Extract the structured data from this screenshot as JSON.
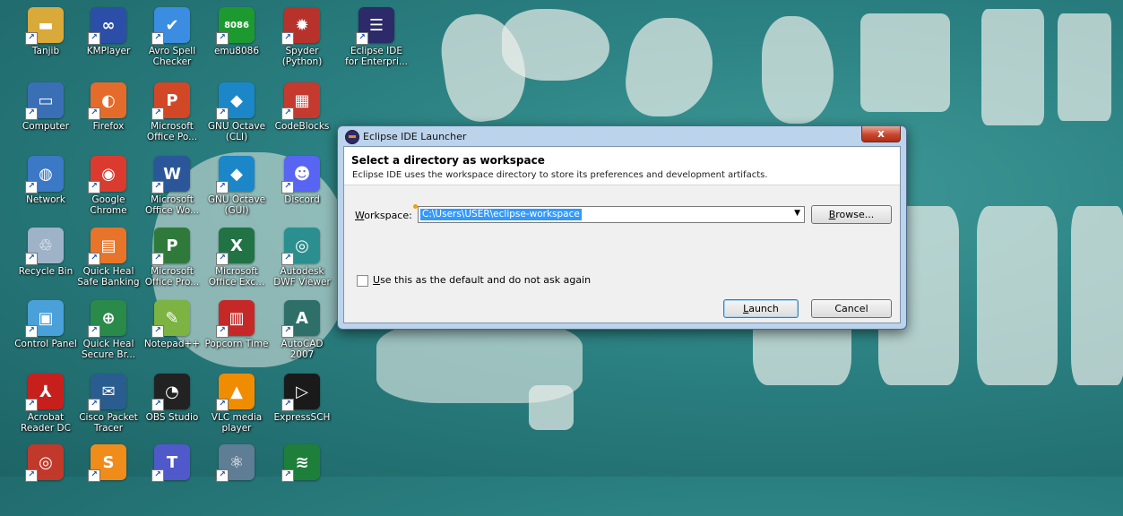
{
  "desktop": {
    "wallpaper_colors": {
      "background": "#2a7f80",
      "ink": "#ebf5f0"
    },
    "icons": [
      {
        "label": "Tanjib",
        "icon": "folder-icon",
        "color": "#d9a93a",
        "glyph": "▬"
      },
      {
        "label": "KMPlayer",
        "icon": "kmplayer-icon",
        "color": "#2b4fa8",
        "glyph": "∞"
      },
      {
        "label": "Avro Spell Checker",
        "icon": "spell-check-icon",
        "color": "#3a8de0",
        "glyph": "✔"
      },
      {
        "label": "emu8086",
        "icon": "chip-icon",
        "color": "#1d9a2f",
        "glyph": "8086"
      },
      {
        "label": "Spyder (Python)",
        "icon": "spider-icon",
        "color": "#b8322c",
        "glyph": "✹"
      },
      {
        "label": "Eclipse IDE for Enterpri...",
        "icon": "eclipse-icon",
        "color": "#2c2a68",
        "glyph": "☰"
      },
      {
        "label": "Computer",
        "icon": "computer-icon",
        "color": "#3b6fb5",
        "glyph": "▭"
      },
      {
        "label": "Firefox",
        "icon": "firefox-icon",
        "color": "#e56b2a",
        "glyph": "◐"
      },
      {
        "label": "Microsoft Office Po...",
        "icon": "powerpoint-icon",
        "color": "#d24726",
        "glyph": "P"
      },
      {
        "label": "GNU Octave (CLI)",
        "icon": "octave-icon",
        "color": "#1b87c9",
        "glyph": "◆"
      },
      {
        "label": "CodeBlocks",
        "icon": "codeblocks-icon",
        "color": "#c43a2f",
        "glyph": "▦"
      },
      {
        "label": "Network",
        "icon": "network-icon",
        "color": "#3b78c6",
        "glyph": "◍"
      },
      {
        "label": "Google Chrome",
        "icon": "chrome-icon",
        "color": "#db3b2f",
        "glyph": "◉"
      },
      {
        "label": "Microsoft Office Wo...",
        "icon": "word-icon",
        "color": "#2b579a",
        "glyph": "W"
      },
      {
        "label": "GNU Octave (GUI)",
        "icon": "octave-icon",
        "color": "#1b87c9",
        "glyph": "◆"
      },
      {
        "label": "Discord",
        "icon": "discord-icon",
        "color": "#5865f2",
        "glyph": "☻"
      },
      {
        "label": "Recycle Bin",
        "icon": "recycle-bin-icon",
        "color": "#9fb3c8",
        "glyph": "♲"
      },
      {
        "label": "Quick Heal Safe Banking",
        "icon": "quickheal-icon",
        "color": "#e8742a",
        "glyph": "▤"
      },
      {
        "label": "Microsoft Office Pro...",
        "icon": "project-icon",
        "color": "#2f7a3b",
        "glyph": "P"
      },
      {
        "label": "Microsoft Office Exc...",
        "icon": "excel-icon",
        "color": "#217346",
        "glyph": "X"
      },
      {
        "label": "Autodesk DWF Viewer",
        "icon": "dwf-viewer-icon",
        "color": "#2c8f8f",
        "glyph": "◎"
      },
      {
        "label": "Control Panel",
        "icon": "control-panel-icon",
        "color": "#4aa0d8",
        "glyph": "▣"
      },
      {
        "label": "Quick Heal Secure Br...",
        "icon": "quickheal-browser-icon",
        "color": "#2a8a4a",
        "glyph": "⊕"
      },
      {
        "label": "Notepad++",
        "icon": "notepadpp-icon",
        "color": "#7cb342",
        "glyph": "✎"
      },
      {
        "label": "Popcorn Time",
        "icon": "popcorn-icon",
        "color": "#c62828",
        "glyph": "▥"
      },
      {
        "label": "AutoCAD 2007",
        "icon": "autocad-icon",
        "color": "#2f6f6a",
        "glyph": "A"
      },
      {
        "label": "Acrobat Reader DC",
        "icon": "acrobat-icon",
        "color": "#c7201c",
        "glyph": "⅄"
      },
      {
        "label": "Cisco Packet Tracer",
        "icon": "packet-tracer-icon",
        "color": "#2a5d8f",
        "glyph": "✉"
      },
      {
        "label": "OBS Studio",
        "icon": "obs-icon",
        "color": "#222222",
        "glyph": "◔"
      },
      {
        "label": "VLC media player",
        "icon": "vlc-icon",
        "color": "#f08c00",
        "glyph": "▲"
      },
      {
        "label": "ExpressSCH",
        "icon": "expresssch-icon",
        "color": "#1a1a1a",
        "glyph": "▷"
      },
      {
        "label": "",
        "icon": "app-icon",
        "color": "#c0392b",
        "glyph": "◎"
      },
      {
        "label": "",
        "icon": "sublime-icon",
        "color": "#f08c1a",
        "glyph": "S"
      },
      {
        "label": "",
        "icon": "teams-icon",
        "color": "#5059c9",
        "glyph": "T"
      },
      {
        "label": "",
        "icon": "atom-icon",
        "color": "#5f7d95",
        "glyph": "⚛"
      },
      {
        "label": "",
        "icon": "circuit-icon",
        "color": "#1e7f3a",
        "glyph": "≋"
      }
    ]
  },
  "dialog": {
    "title": "Eclipse IDE Launcher",
    "close_glyph": "x",
    "heading": "Select a directory as workspace",
    "description": "Eclipse IDE uses the workspace directory to store its preferences and development artifacts.",
    "workspace_label_first": "W",
    "workspace_label_rest": "orkspace:",
    "workspace_value": "C:\\Users\\USER\\eclipse-workspace",
    "dropdown_arrow": "▼",
    "browse_first": "B",
    "browse_rest": "rowse...",
    "checkbox_first": "U",
    "checkbox_rest": "se this as the default and do not ask again",
    "checkbox_checked": false,
    "launch_first": "L",
    "launch_rest": "aunch",
    "cancel_label": "Cancel"
  }
}
